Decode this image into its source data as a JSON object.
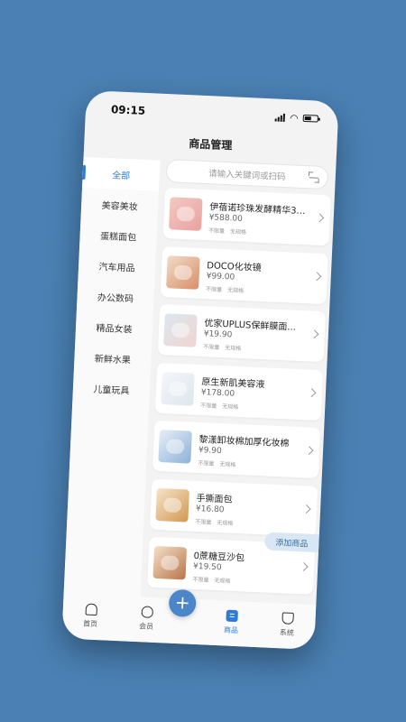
{
  "status": {
    "time": "09:15"
  },
  "header": {
    "title": "商品管理"
  },
  "search": {
    "placeholder": "请输入关键词或扫码"
  },
  "categories": [
    {
      "label": "全部",
      "active": true
    },
    {
      "label": "美容美妆"
    },
    {
      "label": "蛋糕面包"
    },
    {
      "label": "汽车用品"
    },
    {
      "label": "办公数码"
    },
    {
      "label": "精品女装"
    },
    {
      "label": "新鲜水果"
    },
    {
      "label": "儿童玩具"
    }
  ],
  "products": [
    {
      "name": "伊蓓诺珍珠发酵精华3件...",
      "price": "¥588.00",
      "tag1": "不限量",
      "tag2": "无规格",
      "icon": "serum-set-image"
    },
    {
      "name": "DOCO化妆镜",
      "price": "¥99.00",
      "tag1": "不限量",
      "tag2": "无规格",
      "icon": "makeup-mirror-image"
    },
    {
      "name": "优家UPLUS保鲜膜面...",
      "price": "¥19.90",
      "tag1": "不限量",
      "tag2": "无规格",
      "icon": "face-mask-image"
    },
    {
      "name": "原生新肌美容液",
      "price": "¥178.00",
      "tag1": "不限量",
      "tag2": "无规格",
      "icon": "beauty-liquid-image"
    },
    {
      "name": "黎漾卸妆棉加厚化妆棉",
      "price": "¥9.90",
      "tag1": "不限量",
      "tag2": "无规格",
      "icon": "cotton-pads-image"
    },
    {
      "name": "手撕面包",
      "price": "¥16.80",
      "tag1": "不限量",
      "tag2": "无规格",
      "icon": "bread-image"
    },
    {
      "name": "0蔗糖豆沙包",
      "price": "¥19.50",
      "tag1": "不限量",
      "tag2": "无规格",
      "icon": "bean-bun-image"
    }
  ],
  "add_button": "添加商品",
  "tabbar": {
    "home": "首页",
    "member": "会员",
    "goods": "商品",
    "system": "系统",
    "fab": "+"
  },
  "accent_color": "#2e7bd6",
  "background_color": "#4a80b3"
}
